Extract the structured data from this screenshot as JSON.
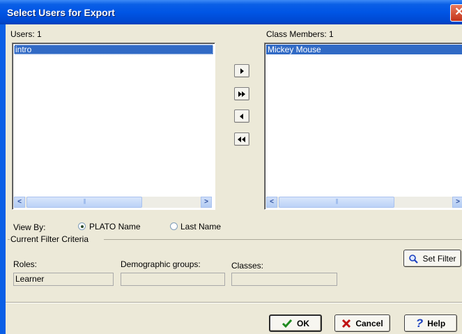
{
  "window": {
    "title": "Select Users for Export",
    "close_glyph": "✕"
  },
  "users": {
    "label": "Users: 1",
    "items": [
      "intro"
    ]
  },
  "members": {
    "label": "Class Members: 1",
    "items": [
      "Mickey Mouse"
    ]
  },
  "move_buttons": {
    "move_one_right": "▶",
    "move_all_right": "▶▶",
    "move_one_left": "◀",
    "move_all_left": "◀◀"
  },
  "scroll": {
    "left": "<",
    "right": ">"
  },
  "view_by": {
    "label": "View By:",
    "options": [
      {
        "label": "PLATO Name",
        "selected": true
      },
      {
        "label": "Last Name",
        "selected": false
      }
    ]
  },
  "filter": {
    "group_label": "Current Filter Criteria",
    "set_filter_label": "Set Filter",
    "roles_label": "Roles:",
    "roles_value": "Learner",
    "demographic_label": "Demographic groups:",
    "demographic_value": "",
    "classes_label": "Classes:",
    "classes_value": ""
  },
  "buttons": {
    "ok": "OK",
    "cancel": "Cancel",
    "help": "Help"
  },
  "colors": {
    "title_bar": "#0055e5",
    "selection": "#316ac5",
    "dialog_bg": "#ece9d8",
    "ok_check": "#1f8a1f",
    "cancel_x": "#c01010",
    "help_q": "#1a3fbf"
  },
  "icons": {
    "set_filter": "magnifier-icon",
    "ok": "checkmark-icon",
    "cancel": "x-icon",
    "help": "question-icon"
  }
}
